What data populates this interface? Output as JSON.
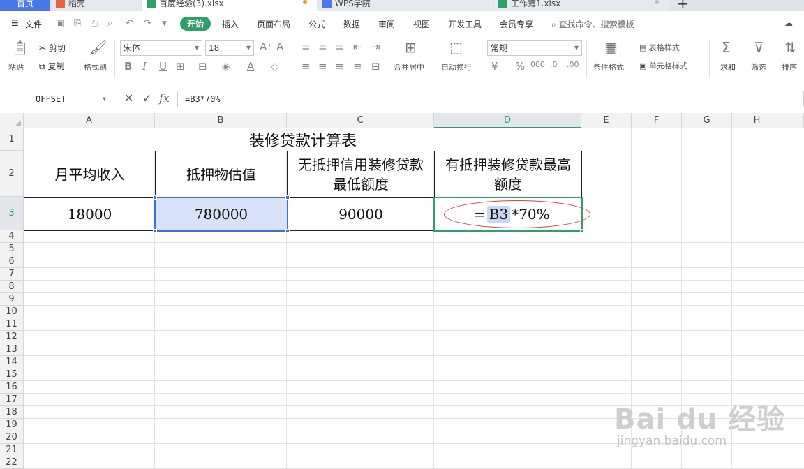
{
  "tabs": [
    {
      "label": "首页",
      "icon": ""
    },
    {
      "label": "稻壳",
      "icon": "docer-icon"
    },
    {
      "label": "百度经验(3).xlsx",
      "icon": "sheet-icon"
    },
    {
      "label": "WPS学院",
      "icon": "wps-icon"
    },
    {
      "label": "工作簿1.xlsx",
      "icon": "sheet-icon"
    }
  ],
  "menu": {
    "file": "文件",
    "items": [
      "开始",
      "插入",
      "页面布局",
      "公式",
      "数据",
      "审阅",
      "视图",
      "开发工具",
      "会员专享"
    ],
    "search": "查找命令、搜索模板"
  },
  "ribbon": {
    "paste": "粘贴",
    "cut": "剪切",
    "copy": "复制",
    "format_painter": "格式刷",
    "font_name": "宋体",
    "font_size": "18",
    "number_format": "常规",
    "merge_center": "合并居中",
    "wrap_text": "自动换行",
    "conditional_format": "条件格式",
    "table_style": "表格样式",
    "cell_style": "单元格样式",
    "sum": "求和",
    "filter": "筛选",
    "sort": "排序"
  },
  "formula_bar": {
    "name_box": "OFFSET",
    "fx": "fx",
    "formula": "=B3*70%"
  },
  "columns": [
    "A",
    "B",
    "C",
    "D",
    "E",
    "F",
    "G",
    "H"
  ],
  "rows": [
    "1",
    "2",
    "3",
    "4",
    "5",
    "6",
    "7",
    "8",
    "9",
    "10",
    "11",
    "12",
    "13",
    "14",
    "15",
    "16",
    "17",
    "18",
    "19",
    "20",
    "21",
    "22"
  ],
  "sheet": {
    "title": "装修贷款计算表",
    "headers": [
      "月平均收入",
      "抵押物估值",
      "无抵押信用装修贷款最低额度",
      "有抵押装修贷款最高额度"
    ],
    "values": [
      "18000",
      "780000",
      "90000"
    ],
    "edit_prefix": "=",
    "edit_ref": "B3",
    "edit_suffix": "*70%"
  },
  "watermark": {
    "brand": "Bai du 经验",
    "url": "jingyan.baidu.com"
  },
  "colors": {
    "accent": "#2e9e6a",
    "selection": "#3a6fd8",
    "annotation": "#d9433c"
  }
}
